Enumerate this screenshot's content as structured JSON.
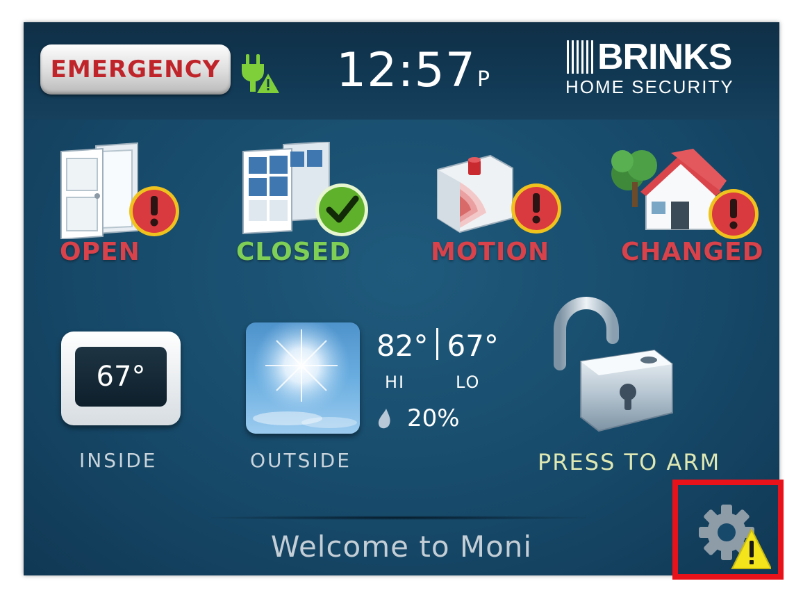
{
  "header": {
    "emergency_label": "EMERGENCY",
    "time": "12:57",
    "ampm": "P",
    "brand_name": "BRINKS",
    "brand_sub": "HOME SECURITY"
  },
  "sensors": [
    {
      "label": "OPEN",
      "status": "alert",
      "icon": "door-icon"
    },
    {
      "label": "CLOSED",
      "status": "ok",
      "icon": "window-icon"
    },
    {
      "label": "MOTION",
      "status": "alert",
      "icon": "motion-sensor-icon"
    },
    {
      "label": "CHANGED",
      "status": "alert",
      "icon": "house-icon"
    }
  ],
  "inside": {
    "temp": "67°",
    "label": "INSIDE"
  },
  "outside": {
    "label": "OUTSIDE",
    "hi": "82°",
    "lo": "67°",
    "hi_label": "HI",
    "lo_label": "LO",
    "precip": "20%"
  },
  "arm": {
    "label": "PRESS TO ARM"
  },
  "footer": {
    "welcome": "Welcome to Moni"
  },
  "colors": {
    "alert": "#d9424a",
    "ok": "#7fcf56",
    "background": "#174a6a",
    "highlight": "#e8121a"
  }
}
